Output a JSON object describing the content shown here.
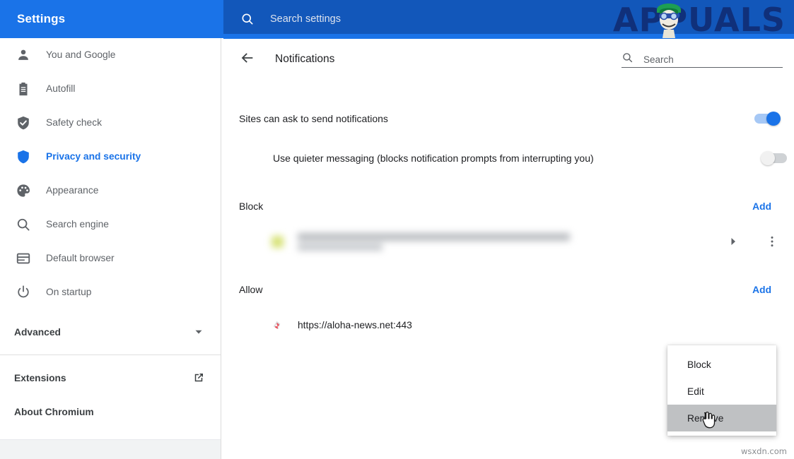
{
  "topbar": {
    "title": "Settings",
    "search_placeholder": "Search settings",
    "search_value": "",
    "search_icon": "search-icon",
    "background_color": "#1a73e8",
    "search_background_color": "#1257ba"
  },
  "watermark": {
    "logo_text": "APPUALS",
    "logo_color": "#10307a",
    "bottom_text": "wsxdn.com"
  },
  "sidebar": {
    "items": [
      {
        "label": "You and Google",
        "icon": "person-icon",
        "active": false
      },
      {
        "label": "Autofill",
        "icon": "clipboard-icon",
        "active": false
      },
      {
        "label": "Safety check",
        "icon": "shield-check-icon",
        "active": false
      },
      {
        "label": "Privacy and security",
        "icon": "shield-half-icon",
        "active": true
      },
      {
        "label": "Appearance",
        "icon": "palette-icon",
        "active": false
      },
      {
        "label": "Search engine",
        "icon": "search-icon",
        "active": false
      },
      {
        "label": "Default browser",
        "icon": "browser-icon",
        "active": false
      },
      {
        "label": "On startup",
        "icon": "power-icon",
        "active": false
      }
    ],
    "advanced": {
      "label": "Advanced",
      "icon": "chevron-down-icon"
    },
    "extensions": {
      "label": "Extensions",
      "icon": "external-link-icon"
    },
    "about": {
      "label": "About Chromium"
    },
    "active_color": "#1a73e8"
  },
  "main": {
    "back_icon": "arrow-left-icon",
    "title": "Notifications",
    "search": {
      "icon": "search-icon",
      "placeholder": "Search",
      "value": ""
    },
    "settings": [
      {
        "label": "Sites can ask to send notifications",
        "toggle": "on",
        "sub": false
      },
      {
        "label": "Use quieter messaging (blocks notification prompts from interrupting you)",
        "toggle": "off",
        "sub": true
      }
    ],
    "sections": [
      {
        "title": "Block",
        "add_label": "Add",
        "entries": [
          {
            "url": "",
            "blurred": true,
            "favicon": "blurred-favicon",
            "expand_icon": "expand-arrow-icon",
            "menu_icon": "kebab-menu-icon"
          }
        ]
      },
      {
        "title": "Allow",
        "add_label": "Add",
        "entries": [
          {
            "url": "https://aloha-news.net:443",
            "blurred": false,
            "favicon": "site-favicon"
          }
        ]
      }
    ],
    "link_color": "#1a73e8"
  },
  "context_menu": {
    "items": [
      {
        "label": "Block",
        "highlighted": false
      },
      {
        "label": "Edit",
        "highlighted": false
      },
      {
        "label": "Remove",
        "highlighted": true
      }
    ],
    "highlight_color": "#bfc1c3"
  },
  "cursor": {
    "type": "pointer-hand-cursor"
  }
}
